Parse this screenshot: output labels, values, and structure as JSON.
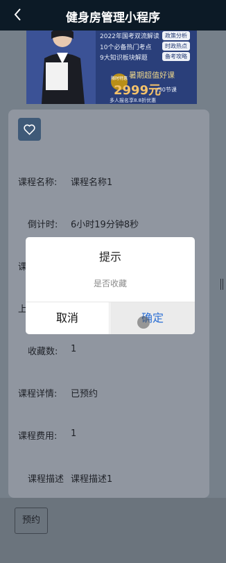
{
  "navbar": {
    "title": "健身房管理小程序"
  },
  "banner": {
    "lines": [
      "2022年国考双流解读",
      "10个必备热门考点",
      "9大知识板块解题"
    ],
    "tags": [
      "政策分析",
      "时政热点",
      "备考攻略"
    ],
    "badge": "限时特惠",
    "promo": "暑期超值好课",
    "price": "2999元",
    "lessons": "/30节课",
    "footnote": "多人报名享8.8折优惠"
  },
  "detail": {
    "course_name_label": "课程名称:",
    "course_name_value": "课程名称1",
    "countdown_label": "倒计时:",
    "countdown_value": "6小时19分钟8秒",
    "partial_label_1": "课",
    "partial_label_2": "上",
    "favorites_label": "收藏数:",
    "favorites_value": "1",
    "course_detail_label": "课程详情:",
    "course_detail_value": "已预约",
    "fee_label": "课程费用:",
    "fee_value": "1",
    "description_label": "课程描述",
    "description_value": "课程描述1"
  },
  "bottom": {
    "reserve_label": "预约"
  },
  "dialog": {
    "title": "提示",
    "content": "是否收藏",
    "cancel_label": "取消",
    "confirm_label": "确定"
  }
}
